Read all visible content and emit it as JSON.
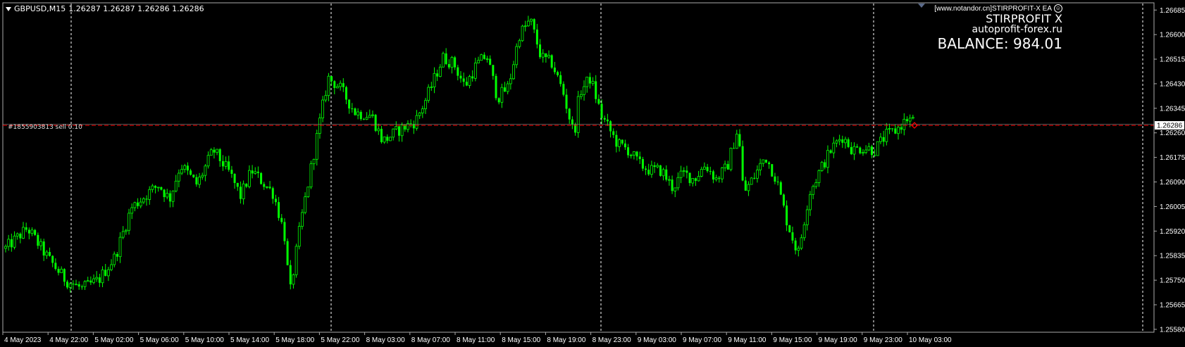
{
  "header": {
    "symbol": "GBPUSD,M15",
    "ohlc": "1.26287 1.26287 1.26286 1.26286"
  },
  "ea_panel": {
    "ea_name": "[www.notandor.cn]STIRPROFIT-X EA",
    "title": "STIRPROFIT X",
    "site": "autoprofit-forex.ru",
    "balance": "BALANCE: 984.01"
  },
  "order_line": {
    "label": "#1855903813 sell 0.10"
  },
  "current_price": "1.26286",
  "colors": {
    "background": "#000000",
    "candles": "#00ff00",
    "grid": "#ffffff",
    "order_line": "#ff0000",
    "text": "#ffffff"
  },
  "chart_data": {
    "type": "candlestick",
    "y_axis": {
      "ticks": [
        "1.26685",
        "1.26600",
        "1.26515",
        "1.26430",
        "1.26345",
        "1.26260",
        "1.26175",
        "1.26090",
        "1.26005",
        "1.25920",
        "1.25835",
        "1.25750",
        "1.25665",
        "1.25580"
      ],
      "range": [
        1.2557,
        1.2671
      ]
    },
    "x_axis": {
      "ticks": [
        "4 May 2023",
        "4 May 22:00",
        "5 May 02:00",
        "5 May 06:00",
        "5 May 10:00",
        "5 May 14:00",
        "5 May 18:00",
        "5 May 22:00",
        "8 May 03:00",
        "8 May 07:00",
        "8 May 11:00",
        "8 May 15:00",
        "8 May 19:00",
        "8 May 23:00",
        "9 May 03:00",
        "9 May 07:00",
        "9 May 11:00",
        "9 May 15:00",
        "9 May 19:00",
        "9 May 23:00",
        "10 May 03:00"
      ]
    },
    "grid": "vertical-dashed",
    "order_price": 1.26286,
    "close_path": [
      [
        0,
        1.2586
      ],
      [
        0.02,
        1.2593
      ],
      [
        0.04,
        1.2582
      ],
      [
        0.055,
        1.2575
      ],
      [
        0.07,
        1.2572
      ],
      [
        0.085,
        1.2575
      ],
      [
        0.1,
        1.2583
      ],
      [
        0.115,
        1.26
      ],
      [
        0.13,
        1.2605
      ],
      [
        0.14,
        1.2608
      ],
      [
        0.15,
        1.2603
      ],
      [
        0.16,
        1.2615
      ],
      [
        0.175,
        1.2608
      ],
      [
        0.19,
        1.262
      ],
      [
        0.205,
        1.2612
      ],
      [
        0.215,
        1.2604
      ],
      [
        0.225,
        1.2613
      ],
      [
        0.235,
        1.2609
      ],
      [
        0.245,
        1.2605
      ],
      [
        0.255,
        1.2591
      ],
      [
        0.26,
        1.257
      ],
      [
        0.27,
        1.2595
      ],
      [
        0.285,
        1.2625
      ],
      [
        0.295,
        1.2645
      ],
      [
        0.305,
        1.2642
      ],
      [
        0.32,
        1.2633
      ],
      [
        0.335,
        1.2632
      ],
      [
        0.345,
        1.2623
      ],
      [
        0.36,
        1.2627
      ],
      [
        0.375,
        1.263
      ],
      [
        0.385,
        1.2638
      ],
      [
        0.4,
        1.2652
      ],
      [
        0.41,
        1.265
      ],
      [
        0.42,
        1.2642
      ],
      [
        0.43,
        1.2649
      ],
      [
        0.44,
        1.2653
      ],
      [
        0.45,
        1.2638
      ],
      [
        0.46,
        1.2642
      ],
      [
        0.47,
        1.266
      ],
      [
        0.48,
        1.2665
      ],
      [
        0.49,
        1.2652
      ],
      [
        0.5,
        1.265
      ],
      [
        0.51,
        1.264
      ],
      [
        0.52,
        1.2625
      ],
      [
        0.525,
        1.264
      ],
      [
        0.535,
        1.2645
      ],
      [
        0.545,
        1.2632
      ],
      [
        0.56,
        1.2622
      ],
      [
        0.57,
        1.262
      ],
      [
        0.58,
        1.2615
      ],
      [
        0.59,
        1.2613
      ],
      [
        0.6,
        1.2613
      ],
      [
        0.61,
        1.2607
      ],
      [
        0.62,
        1.2612
      ],
      [
        0.63,
        1.261
      ],
      [
        0.64,
        1.2615
      ],
      [
        0.65,
        1.261
      ],
      [
        0.66,
        1.2614
      ],
      [
        0.67,
        1.2628
      ],
      [
        0.675,
        1.2605
      ],
      [
        0.685,
        1.2611
      ],
      [
        0.695,
        1.2618
      ],
      [
        0.705,
        1.261
      ],
      [
        0.715,
        1.2595
      ],
      [
        0.725,
        1.2584
      ],
      [
        0.735,
        1.2605
      ],
      [
        0.745,
        1.2613
      ],
      [
        0.755,
        1.262
      ],
      [
        0.765,
        1.2625
      ],
      [
        0.775,
        1.262
      ],
      [
        0.785,
        1.2621
      ],
      [
        0.795,
        1.262
      ],
      [
        0.805,
        1.2625
      ],
      [
        0.815,
        1.2627
      ],
      [
        0.825,
        1.2631
      ],
      [
        0.83,
        1.263
      ]
    ]
  }
}
